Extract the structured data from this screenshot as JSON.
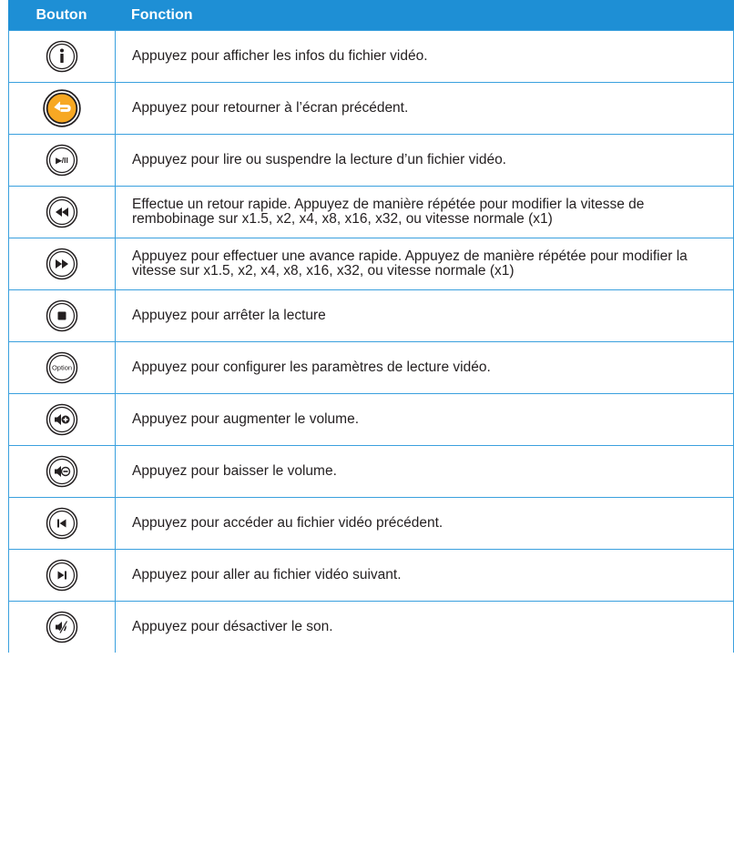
{
  "header": {
    "col_button": "Bouton",
    "col_function": "Fonction"
  },
  "rows": [
    {
      "icon": "info-icon",
      "text": "Appuyez pour afficher les infos du fichier vidéo."
    },
    {
      "icon": "back-icon",
      "text": "Appuyez pour retourner à l’écran précédent."
    },
    {
      "icon": "play-pause-icon",
      "text": "Appuyez pour lire ou suspendre la lecture d’un fichier vidéo."
    },
    {
      "icon": "rewind-icon",
      "text": "Effectue un retour rapide. Appuyez de manière répétée pour modifier la vitesse de rembobinage sur x1.5, x2, x4, x8, x16, x32, ou vitesse normale (x1)"
    },
    {
      "icon": "fast-forward-icon",
      "text": "Appuyez pour effectuer une avance rapide. Appuyez de manière répétée pour modifier la vitesse sur  x1.5, x2, x4, x8, x16, x32, ou vitesse normale (x1)"
    },
    {
      "icon": "stop-icon",
      "text": "Appuyez pour arrêter la lecture"
    },
    {
      "icon": "option-icon",
      "text": "Appuyez pour configurer les paramètres de lecture vidéo."
    },
    {
      "icon": "volume-up-icon",
      "text": "Appuyez pour augmenter le volume."
    },
    {
      "icon": "volume-down-icon",
      "text": "Appuyez pour baisser le volume."
    },
    {
      "icon": "previous-icon",
      "text": "Appuyez pour accéder au fichier vidéo précédent."
    },
    {
      "icon": "next-icon",
      "text": "Appuyez pour aller au fichier vidéo suivant."
    },
    {
      "icon": "mute-icon",
      "text": "Appuyez pour désactiver le son."
    }
  ],
  "icon_labels": {
    "play_pause": "▶/II",
    "option": "Option"
  },
  "colors": {
    "header_bg": "#1e8fd5",
    "border": "#3aa0de",
    "back_button": "#f7a823"
  }
}
